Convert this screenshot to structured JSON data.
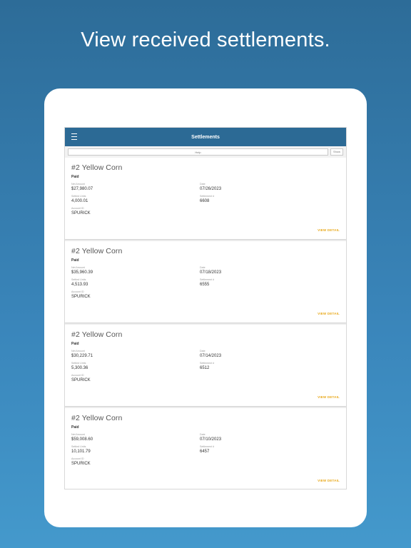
{
  "headline": "View received settlements.",
  "app": {
    "title": "Settlements",
    "search_placeholder": "Help",
    "show_label": "Show"
  },
  "labels": {
    "net_amount": "Net Amount",
    "date": "Date",
    "settled_units": "Settled Units",
    "settlement_no": "Settlement #",
    "account_id": "Account ID",
    "view_detail": "VIEW DETAIL"
  },
  "settlements": [
    {
      "commodity": "#2 Yellow Corn",
      "status": "Paid",
      "net_amount": "$27,980.07",
      "date": "07/26/2023",
      "settled_units": "4,000.01",
      "settlement_no": "6608",
      "account_id": "SPURICK"
    },
    {
      "commodity": "#2 Yellow Corn",
      "status": "Paid",
      "net_amount": "$35,960.39",
      "date": "07/18/2023",
      "settled_units": "4,513.93",
      "settlement_no": "6555",
      "account_id": "SPURICK"
    },
    {
      "commodity": "#2 Yellow Corn",
      "status": "Paid",
      "net_amount": "$30,229.71",
      "date": "07/14/2023",
      "settled_units": "5,300.36",
      "settlement_no": "6512",
      "account_id": "SPURICK"
    },
    {
      "commodity": "#2 Yellow Corn",
      "status": "Paid",
      "net_amount": "$59,008.60",
      "date": "07/10/2023",
      "settled_units": "10,101.79",
      "settlement_no": "6457",
      "account_id": "SPURICK"
    }
  ]
}
